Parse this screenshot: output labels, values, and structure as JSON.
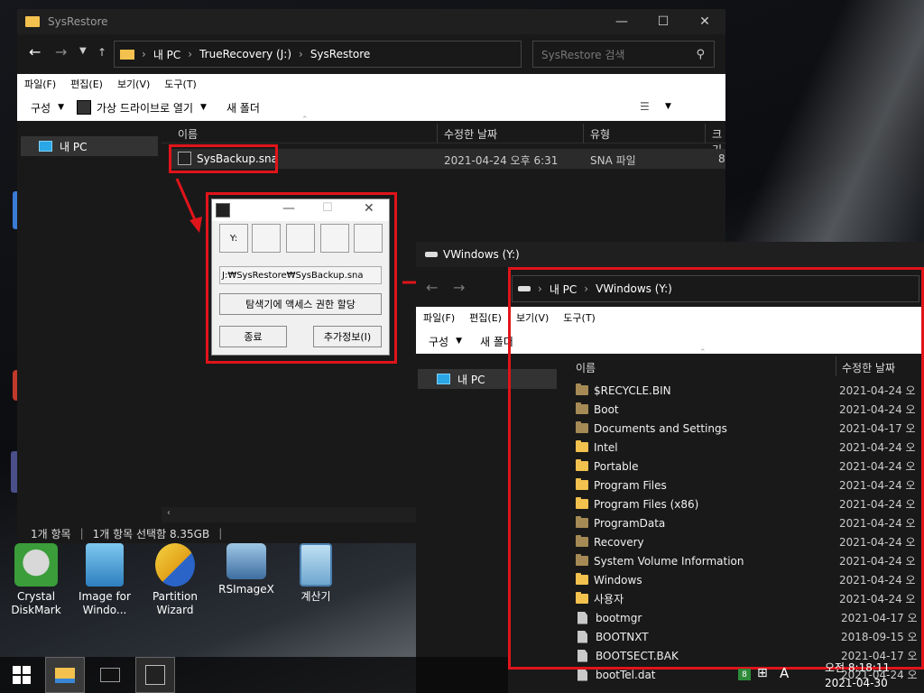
{
  "window1": {
    "title": "SysRestore",
    "breadcrumb": [
      "내 PC",
      "TrueRecovery (J:)",
      "SysRestore"
    ],
    "search_placeholder": "SysRestore 검색",
    "menu": [
      "파일(F)",
      "편집(E)",
      "보기(V)",
      "도구(T)"
    ],
    "cmd": {
      "organize": "구성",
      "mount": "가상 드라이브로 열기",
      "new_folder": "새 폴더"
    },
    "columns": [
      "이름",
      "수정한 날짜",
      "유형",
      "크기"
    ],
    "nav_item": "내 PC",
    "file": {
      "name": "SysBackup.sna",
      "date": "2021-04-24 오후 6:31",
      "type": "SNA 파일",
      "size": "8"
    },
    "status": {
      "count": "1개 항목",
      "selected": "1개 항목 선택함 8.35GB"
    }
  },
  "dialog": {
    "drive_slot": "Y:",
    "path": "J:₩SysRestore₩SysBackup.sna",
    "grant_button": "탐색기에 액세스 권한 할당",
    "close_button": "종료",
    "info_button": "추가정보(I)"
  },
  "window2": {
    "title": "VWindows (Y:)",
    "breadcrumb": [
      "내 PC",
      "VWindows (Y:)"
    ],
    "menu": [
      "파일(F)",
      "편집(E)",
      "보기(V)",
      "도구(T)"
    ],
    "cmd": {
      "organize": "구성",
      "new_folder": "새 폴더"
    },
    "columns": [
      "이름",
      "수정한 날짜"
    ],
    "nav_item": "내 PC",
    "items": [
      {
        "name": "$RECYCLE.BIN",
        "date": "2021-04-24 오",
        "kind": "folder-dark"
      },
      {
        "name": "Boot",
        "date": "2021-04-24 오",
        "kind": "folder-dark"
      },
      {
        "name": "Documents and Settings",
        "date": "2021-04-17 오",
        "kind": "folder-dark"
      },
      {
        "name": "Intel",
        "date": "2021-04-24 오",
        "kind": "folder"
      },
      {
        "name": "Portable",
        "date": "2021-04-24 오",
        "kind": "folder"
      },
      {
        "name": "Program Files",
        "date": "2021-04-24 오",
        "kind": "folder"
      },
      {
        "name": "Program Files (x86)",
        "date": "2021-04-24 오",
        "kind": "folder"
      },
      {
        "name": "ProgramData",
        "date": "2021-04-24 오",
        "kind": "folder-dark"
      },
      {
        "name": "Recovery",
        "date": "2021-04-24 오",
        "kind": "folder-dark"
      },
      {
        "name": "System Volume Information",
        "date": "2021-04-24 오",
        "kind": "folder-dark"
      },
      {
        "name": "Windows",
        "date": "2021-04-24 오",
        "kind": "folder"
      },
      {
        "name": "사용자",
        "date": "2021-04-24 오",
        "kind": "folder"
      },
      {
        "name": "bootmgr",
        "date": "2021-04-17 오",
        "kind": "file"
      },
      {
        "name": "BOOTNXT",
        "date": "2018-09-15 오",
        "kind": "file"
      },
      {
        "name": "BOOTSECT.BAK",
        "date": "2021-04-17 오",
        "kind": "file"
      },
      {
        "name": "bootTel.dat",
        "date": "2021-04-24 오",
        "kind": "file"
      }
    ]
  },
  "desktop_icons": [
    {
      "label": "Crystal DiskMark"
    },
    {
      "label": "Image for Windo..."
    },
    {
      "label": "Partition Wizard"
    },
    {
      "label": "RSImageX"
    },
    {
      "label": "계산기"
    }
  ],
  "taskbar": {
    "badge": "8",
    "ime": "A",
    "time": "오전 8:18:11",
    "date": "2021-04-30"
  },
  "colors": {
    "highlight_red": "#e0141a",
    "folder": "#f2c14e"
  }
}
